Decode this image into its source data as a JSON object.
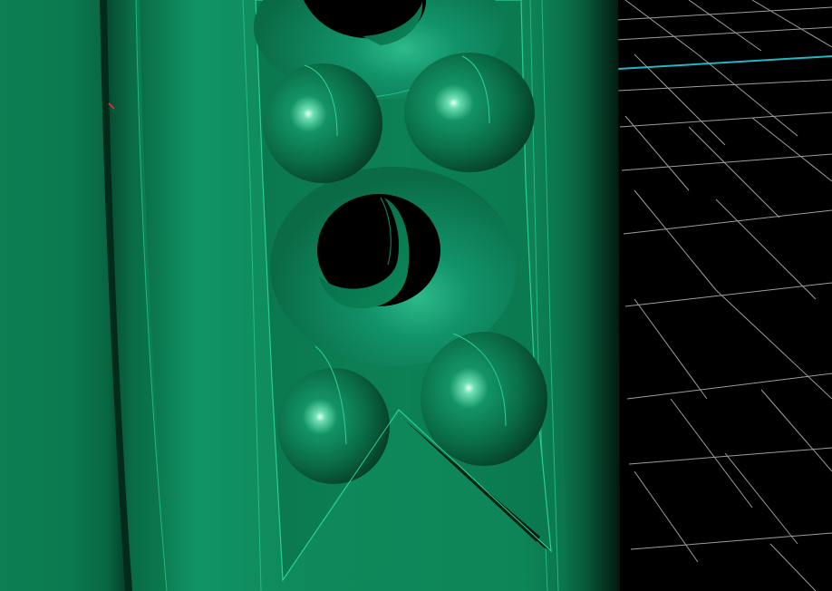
{
  "viewport": {
    "background_color": "#000000",
    "grid_color": "#c8c8c8",
    "axis_color": "#21b8c6",
    "model_color": "#0f8a5c",
    "model_dark_color": "#064a31",
    "model_edge_color": "#2ad59a",
    "highlight_color": "#dffff2"
  }
}
